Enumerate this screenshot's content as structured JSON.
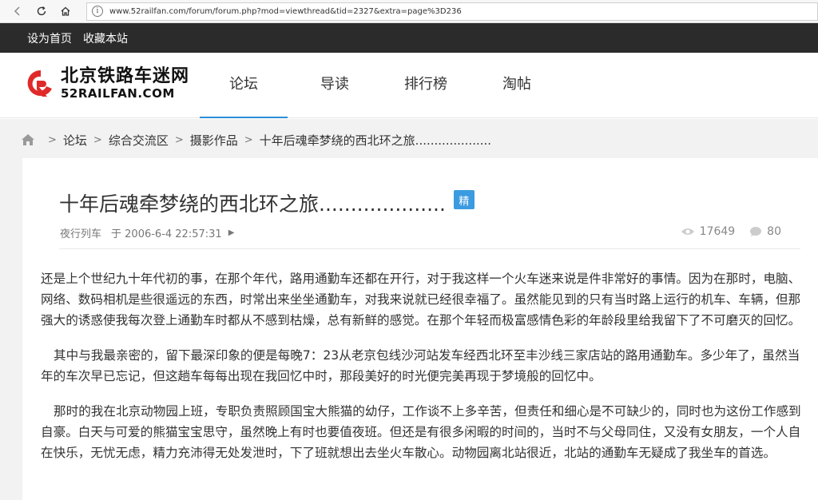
{
  "browser": {
    "url": "www.52railfan.com/forum/forum.php?mod=viewthread&tid=2327&extra=page%3D236"
  },
  "topbar": {
    "items": [
      "设为首页",
      "收藏本站"
    ]
  },
  "logo": {
    "cn": "北京铁路车迷网",
    "en": "52RAILFAN.COM"
  },
  "nav": {
    "items": [
      "论坛",
      "导读",
      "排行榜",
      "淘帖"
    ],
    "active": "论坛"
  },
  "breadcrumb": {
    "items": [
      "论坛",
      "综合交流区",
      "摄影作品",
      "十年后魂牵梦绕的西北环之旅...................."
    ]
  },
  "thread": {
    "title": "十年后魂牵梦绕的西北环之旅....................",
    "badge": "精",
    "author": "夜行列车",
    "posted": "于 2006-6-4 22:57:31",
    "views": "17649",
    "replies": "80",
    "paragraphs": [
      "还是上个世纪九十年代初的事，在那个年代，路用通勤车还都在开行，对于我这样一个火车迷来说是件非常好的事情。因为在那时，电脑、网络、数码相机是些很遥远的东西，时常出来坐坐通勤车，对我来说就已经很幸福了。虽然能见到的只有当时路上运行的机车、车辆，但那强大的诱惑使我每次登上通勤车时都从不感到枯燥，总有新鲜的感觉。在那个年轻而极富感情色彩的年龄段里给我留下了不可磨灭的回忆。",
      "其中与我最亲密的，留下最深印象的便是每晚7：23从老京包线沙河站发车经西北环至丰沙线三家店站的路用通勤车。多少年了，虽然当年的车次早已忘记，但这趟车每每出现在我回忆中时，那段美好的时光便完美再现于梦境般的回忆中。",
      "那时的我在北京动物园上班，专职负责照顾国宝大熊猫的幼仔，工作谈不上多辛苦，但责任和细心是不可缺少的，同时也为这份工作感到自豪。白天与可爱的熊猫宝宝思守，虽然晚上有时也要值夜班。但还是有很多闲暇的时间的，当时不与父母同住，又没有女朋友，一个人自在快乐，无忧无虑，精力充沛得无处发泄时，下了班就想出去坐火车散心。动物园离北站很近，北站的通勤车无疑成了我坐车的首选。"
    ]
  },
  "colors": {
    "accent": "#2a8fd6",
    "badge": "#3b9be0",
    "topbar": "#2b2b2b"
  }
}
